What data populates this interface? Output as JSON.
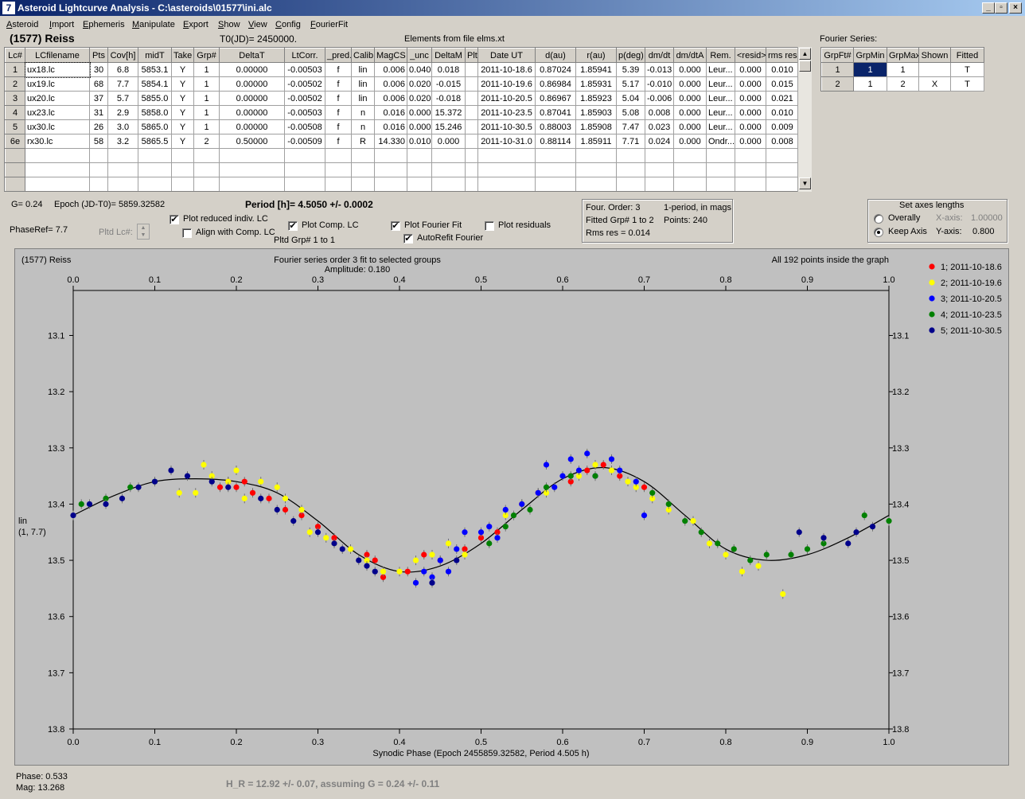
{
  "window": {
    "title": "Asteroid Lightcurve Analysis - C:\\asteroids\\01577\\ini.alc",
    "icon_label": "7",
    "btn_min": "_",
    "btn_max": "▫",
    "btn_close": "×"
  },
  "menu": [
    "Asteroid",
    "Import",
    "Ephemeris",
    "Manipulate",
    "Export",
    "Show",
    "View",
    "Config",
    "FourierFit"
  ],
  "header": {
    "object": "(1577) Reiss",
    "t0": "T0(JD)= 2450000.",
    "elements": "Elements from file elms.xt",
    "fourier_label": "Fourier Series:"
  },
  "lc_table": {
    "columns": [
      "Lc#",
      "LCfilename",
      "Pts",
      "Cov[h]",
      "midT",
      "Take",
      "Grp#",
      "DeltaT",
      "LtCorr.",
      "_pred.",
      "Calib",
      "MagCS",
      "_unc",
      "DeltaM",
      "Plt",
      "Date UT",
      "d(au)",
      "r(au)",
      "p(deg)",
      "dm/dt",
      "dm/dtA",
      "Rem.",
      "<resid>",
      "rms res"
    ],
    "rows": [
      [
        "1",
        "ux18.lc",
        "30",
        "6.8",
        "5853.1",
        "Y",
        "1",
        "0.00000",
        "-0.00503",
        "f",
        "lin",
        "0.006",
        "0.040",
        "0.018",
        "",
        "2011-10-18.6",
        "0.87024",
        "1.85941",
        "5.39",
        "-0.013",
        "0.000",
        "Leur...",
        "0.000",
        "0.010"
      ],
      [
        "2",
        "ux19.lc",
        "68",
        "7.7",
        "5854.1",
        "Y",
        "1",
        "0.00000",
        "-0.00502",
        "f",
        "lin",
        "0.006",
        "0.020",
        "-0.015",
        "",
        "2011-10-19.6",
        "0.86984",
        "1.85931",
        "5.17",
        "-0.010",
        "0.000",
        "Leur...",
        "0.000",
        "0.015"
      ],
      [
        "3",
        "ux20.lc",
        "37",
        "5.7",
        "5855.0",
        "Y",
        "1",
        "0.00000",
        "-0.00502",
        "f",
        "lin",
        "0.006",
        "0.020",
        "-0.018",
        "",
        "2011-10-20.5",
        "0.86967",
        "1.85923",
        "5.04",
        "-0.006",
        "0.000",
        "Leur...",
        "0.000",
        "0.021"
      ],
      [
        "4",
        "ux23.lc",
        "31",
        "2.9",
        "5858.0",
        "Y",
        "1",
        "0.00000",
        "-0.00503",
        "f",
        "n",
        "0.016",
        "0.000",
        "15.372",
        "",
        "2011-10-23.5",
        "0.87041",
        "1.85903",
        "5.08",
        "0.008",
        "0.000",
        "Leur...",
        "0.000",
        "0.010"
      ],
      [
        "5",
        "ux30.lc",
        "26",
        "3.0",
        "5865.0",
        "Y",
        "1",
        "0.00000",
        "-0.00508",
        "f",
        "n",
        "0.016",
        "0.000",
        "15.246",
        "",
        "2011-10-30.5",
        "0.88003",
        "1.85908",
        "7.47",
        "0.023",
        "0.000",
        "Leur...",
        "0.000",
        "0.009"
      ],
      [
        "6e",
        "rx30.lc",
        "58",
        "3.2",
        "5865.5",
        "Y",
        "2",
        "0.50000",
        "-0.00509",
        "f",
        "R",
        "14.330",
        "0.010",
        "0.000",
        "",
        "2011-10-31.0",
        "0.88114",
        "1.85911",
        "7.71",
        "0.024",
        "0.000",
        "Ondr...",
        "0.000",
        "0.008"
      ]
    ]
  },
  "fourier_table": {
    "columns": [
      "GrpFt#",
      "GrpMin",
      "GrpMax",
      "Shown",
      "Fitted"
    ],
    "rows": [
      [
        "1",
        "1",
        "1",
        "",
        "T"
      ],
      [
        "2",
        "1",
        "2",
        "X",
        "T"
      ]
    ]
  },
  "controls": {
    "g": "G= 0.24",
    "epoch": "Epoch (JD-T0)= 5859.32582",
    "period": "Period [h]= 4.5050 +/- 0.0002",
    "phaseref": "PhaseRef= 7.7",
    "pltd_lc": "Pltd Lc#:",
    "pltd_grp": "Pltd Grp#  1   to   1",
    "plot_reduced": "Plot reduced indiv. LC",
    "align_comp": "Align with Comp. LC",
    "plot_comp": "Plot Comp. LC",
    "plot_fourier": "Plot Fourier Fit",
    "autorefit": "AutoRefit Fourier",
    "plot_residuals": "Plot residuals",
    "checks": {
      "plot_reduced": true,
      "align_comp": false,
      "plot_comp": true,
      "plot_fourier": true,
      "autorefit": true,
      "plot_residuals": false
    },
    "info_order": "Four. Order:  3",
    "info_period": "1-period, in mags",
    "info_fitted": "Fitted Grp# 1 to 2",
    "info_points": "Points: 240",
    "info_rms": "Rms res     = 0.014",
    "axes_title": "Set axes lengths",
    "overally": "Overally",
    "keep_axis": "Keep Axis",
    "xaxis_label": "X-axis:",
    "xaxis_val": "1.00000",
    "yaxis_label": "Y-axis:",
    "yaxis_val": "0.800",
    "check_mark": "✔"
  },
  "status": {
    "phase": "Phase:  0.533",
    "mag": "Mag:    13.268",
    "hr": "H_R = 12.92 +/- 0.07, assuming G = 0.24 +/- 0.11"
  },
  "chart_data": {
    "type": "scatter",
    "top_left": "(1577) Reiss",
    "title": "Fourier series order 3 fit to selected groups",
    "subtitle": "Amplitude: 0.180",
    "top_right": "All 192 points inside the graph",
    "xlabel": "Synodic Phase (Epoch 2455859.32582, Period 4.505 h)",
    "ylabel": [
      "lin",
      "(1, 7.7)"
    ],
    "xlim": [
      0.0,
      1.0
    ],
    "ylim": [
      13.8,
      13.02
    ],
    "x_ticks": [
      "0.0",
      "0.1",
      "0.2",
      "0.3",
      "0.4",
      "0.5",
      "0.6",
      "0.7",
      "0.8",
      "0.9",
      "1.0"
    ],
    "y_ticks": [
      "13.1",
      "13.2",
      "13.3",
      "13.4",
      "13.5",
      "13.6",
      "13.7",
      "13.8"
    ],
    "y_tick_values": [
      13.1,
      13.2,
      13.3,
      13.4,
      13.5,
      13.6,
      13.7,
      13.8
    ],
    "fit": {
      "phase": [
        0.0,
        0.05,
        0.1,
        0.15,
        0.2,
        0.25,
        0.3,
        0.35,
        0.4,
        0.45,
        0.5,
        0.55,
        0.6,
        0.65,
        0.7,
        0.75,
        0.8,
        0.85,
        0.9,
        0.95,
        1.0
      ],
      "mag": [
        13.42,
        13.385,
        13.36,
        13.355,
        13.36,
        13.38,
        13.43,
        13.49,
        13.52,
        13.51,
        13.47,
        13.41,
        13.355,
        13.335,
        13.36,
        13.42,
        13.48,
        13.5,
        13.49,
        13.46,
        13.42
      ]
    },
    "series": [
      {
        "name": "1; 2011-10-18.6",
        "color": "#ff0000",
        "x": [
          0.18,
          0.19,
          0.2,
          0.21,
          0.22,
          0.24,
          0.26,
          0.28,
          0.3,
          0.32,
          0.36,
          0.37,
          0.38,
          0.41,
          0.43,
          0.45,
          0.48,
          0.5,
          0.52,
          0.55,
          0.57,
          0.61,
          0.63,
          0.65,
          0.67,
          0.7
        ],
        "y": [
          13.37,
          13.36,
          13.37,
          13.36,
          13.38,
          13.39,
          13.41,
          13.42,
          13.44,
          13.46,
          13.49,
          13.5,
          13.53,
          13.52,
          13.49,
          13.5,
          13.48,
          13.46,
          13.45,
          13.4,
          13.38,
          13.36,
          13.34,
          13.33,
          13.35,
          13.37
        ]
      },
      {
        "name": "2; 2011-10-19.6",
        "color": "#ffff00",
        "x": [
          0.13,
          0.15,
          0.16,
          0.17,
          0.19,
          0.2,
          0.21,
          0.23,
          0.25,
          0.26,
          0.28,
          0.29,
          0.31,
          0.32,
          0.34,
          0.36,
          0.38,
          0.4,
          0.42,
          0.44,
          0.46,
          0.48,
          0.53,
          0.55,
          0.58,
          0.62,
          0.64,
          0.66,
          0.68,
          0.69,
          0.71,
          0.73,
          0.76,
          0.78,
          0.8,
          0.82,
          0.84,
          0.87
        ],
        "y": [
          13.38,
          13.38,
          13.33,
          13.35,
          13.36,
          13.34,
          13.39,
          13.36,
          13.37,
          13.39,
          13.41,
          13.45,
          13.46,
          13.47,
          13.48,
          13.5,
          13.52,
          13.52,
          13.5,
          13.49,
          13.47,
          13.49,
          13.42,
          13.4,
          13.38,
          13.35,
          13.33,
          13.34,
          13.36,
          13.37,
          13.39,
          13.41,
          13.43,
          13.47,
          13.49,
          13.52,
          13.51,
          13.56
        ]
      },
      {
        "name": "3; 2011-10-20.5",
        "color": "#0000ff",
        "x": [
          0.42,
          0.43,
          0.44,
          0.45,
          0.46,
          0.47,
          0.48,
          0.5,
          0.51,
          0.52,
          0.53,
          0.55,
          0.57,
          0.58,
          0.59,
          0.6,
          0.61,
          0.62,
          0.63,
          0.64,
          0.66,
          0.67,
          0.69,
          0.7
        ],
        "y": [
          13.54,
          13.52,
          13.53,
          13.5,
          13.52,
          13.48,
          13.45,
          13.45,
          13.44,
          13.46,
          13.41,
          13.4,
          13.38,
          13.33,
          13.37,
          13.35,
          13.32,
          13.34,
          13.31,
          13.35,
          13.32,
          13.34,
          13.36,
          13.42
        ]
      },
      {
        "name": "4; 2011-10-23.5",
        "color": "#008000",
        "x": [
          0.01,
          0.04,
          0.07,
          0.1,
          0.51,
          0.53,
          0.54,
          0.56,
          0.58,
          0.61,
          0.64,
          0.71,
          0.73,
          0.75,
          0.77,
          0.79,
          0.81,
          0.83,
          0.85,
          0.88,
          0.9,
          0.92,
          0.97,
          1.0
        ],
        "y": [
          13.4,
          13.39,
          13.37,
          13.36,
          13.47,
          13.44,
          13.42,
          13.41,
          13.37,
          13.35,
          13.35,
          13.38,
          13.4,
          13.43,
          13.45,
          13.47,
          13.48,
          13.5,
          13.49,
          13.49,
          13.48,
          13.47,
          13.42,
          13.43
        ]
      },
      {
        "name": "5; 2011-10-30.5",
        "color": "#00008b",
        "x": [
          0.0,
          0.02,
          0.04,
          0.06,
          0.08,
          0.1,
          0.12,
          0.14,
          0.17,
          0.19,
          0.23,
          0.25,
          0.27,
          0.3,
          0.32,
          0.33,
          0.35,
          0.36,
          0.37,
          0.44,
          0.47,
          0.89,
          0.92,
          0.95,
          0.96,
          0.98
        ],
        "y": [
          13.42,
          13.4,
          13.4,
          13.39,
          13.37,
          13.36,
          13.34,
          13.35,
          13.36,
          13.37,
          13.39,
          13.41,
          13.43,
          13.45,
          13.47,
          13.48,
          13.5,
          13.51,
          13.52,
          13.54,
          13.5,
          13.45,
          13.46,
          13.47,
          13.45,
          13.44
        ]
      }
    ]
  }
}
